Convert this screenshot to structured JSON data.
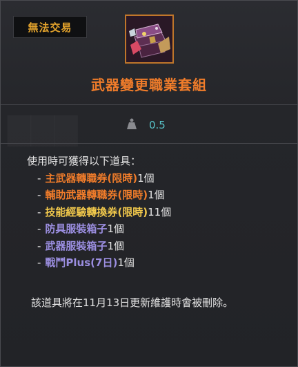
{
  "tooltip": {
    "tag_label": "無法交易",
    "item_name": "武器變更職業套組",
    "weight_value": "0.5",
    "description_header": "使用時可獲得以下道具：",
    "rewards": [
      {
        "name": "主武器轉職券(限時)",
        "qty": "1個",
        "color": "#f07c2a"
      },
      {
        "name": "輔助武器轉職券(限時)",
        "qty": "1個",
        "color": "#f07c2a"
      },
      {
        "name": "技能經驗轉換券(限時)",
        "qty": "11個",
        "color": "#f2c94c"
      },
      {
        "name": "防具服裝箱子",
        "qty": "1個",
        "color": "#9b8ee0"
      },
      {
        "name": "武器服裝箱子",
        "qty": "1個",
        "color": "#9b8ee0"
      },
      {
        "name": "戰鬥Plus(7日)",
        "qty": "1個",
        "color": "#9b8ee0"
      }
    ],
    "dash": "-",
    "deletion_notice": "該道具將在11月13日更新維護時會被刪除。"
  },
  "colors": {
    "tag_text": "#e3a32c",
    "title": "#f07c2a",
    "weight_value": "#58c3c9",
    "border": "#c0762a"
  },
  "icons": {
    "item_icon": "treasure-chest-icon",
    "weight_icon": "weight-icon"
  }
}
